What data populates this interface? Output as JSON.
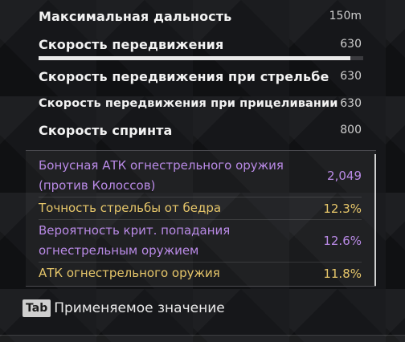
{
  "stats": [
    {
      "label": "Максимальная дальность",
      "value": "150m"
    },
    {
      "label": "Скорость передвижения",
      "value": "630",
      "progress": 0.96
    },
    {
      "label": "Скорость передвижения при стрельбе",
      "value": "630"
    },
    {
      "label": "Скорость передвижения при прицеливании",
      "value": "630"
    },
    {
      "label": "Скорость спринта",
      "value": "800"
    }
  ],
  "bonus": [
    {
      "label_line1": "Бонусная АТК огнестрельного оружия",
      "label_line2": "(против Колоссов)",
      "value": "2,049",
      "color": "#b98ae6"
    },
    {
      "label_line1": "Точность стрельбы от бедра",
      "label_line2": "",
      "value": "12.3%",
      "color": "#e6c66a"
    },
    {
      "label_line1": "Вероятность крит. попадания",
      "label_line2": "огнестрельным оружием",
      "value": "12.6%",
      "color": "#b98ae6"
    },
    {
      "label_line1": "АТК огнестрельного оружия",
      "label_line2": "",
      "value": "11.8%",
      "color": "#e6c66a"
    }
  ],
  "footer": {
    "key": "Tab",
    "text": "Применяемое значение"
  }
}
